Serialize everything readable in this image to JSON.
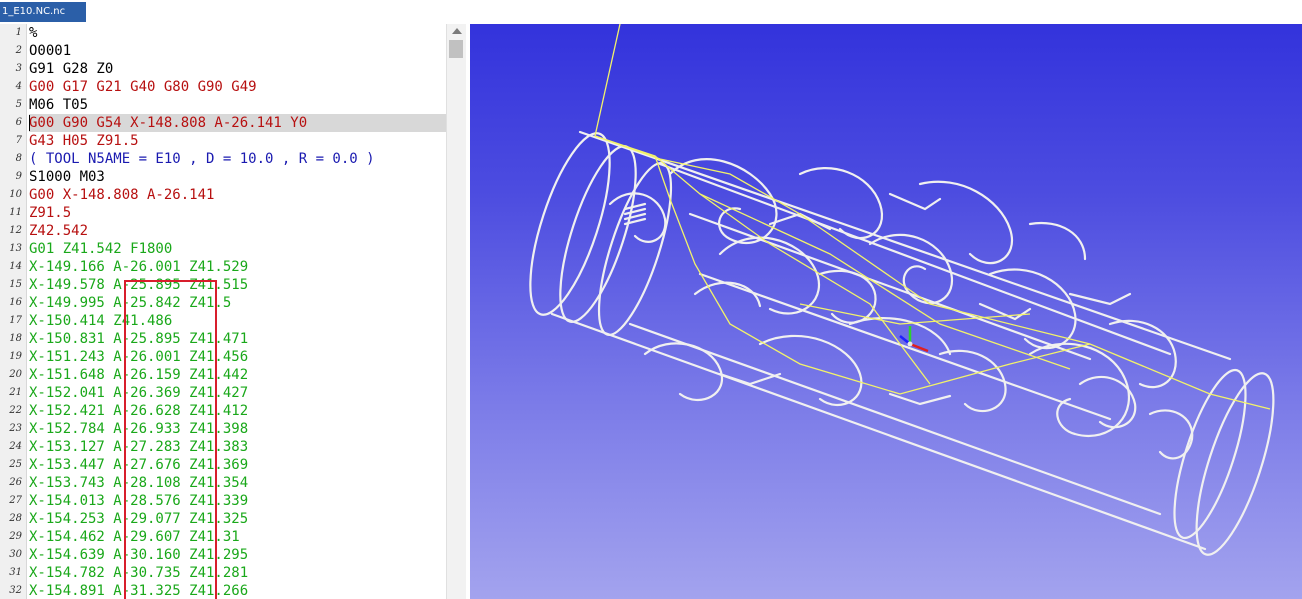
{
  "tab": {
    "title": "1_E10.NC.nc"
  },
  "editor": {
    "lines": [
      {
        "num": "1",
        "text": "%",
        "color": "#000000"
      },
      {
        "num": "2",
        "text": "O0001",
        "color": "#000000"
      },
      {
        "num": "3",
        "text": "G91 G28 Z0",
        "color": "#000000"
      },
      {
        "num": "4",
        "text": "G00 G17 G21 G40 G80 G90 G49",
        "color": "#b71010"
      },
      {
        "num": "5",
        "text": "M06 T05",
        "color": "#000000"
      },
      {
        "num": "6",
        "text": "G00 G90 G54 X-148.808 A-26.141 Y0",
        "color": "#b71010"
      },
      {
        "num": "7",
        "text": "G43 H05 Z91.5",
        "color": "#b71010"
      },
      {
        "num": "8",
        "text": "( TOOL N5AME = E10 , D = 10.0 , R = 0.0 )",
        "color": "#1a1ab0"
      },
      {
        "num": "9",
        "text": "S1000 M03",
        "color": "#000000"
      },
      {
        "num": "10",
        "text": "G00 X-148.808 A-26.141",
        "color": "#b71010"
      },
      {
        "num": "11",
        "text": "Z91.5",
        "color": "#b71010"
      },
      {
        "num": "12",
        "text": "Z42.542",
        "color": "#b71010"
      },
      {
        "num": "13",
        "text": "G01 Z41.542 F1800",
        "color": "#1aa81a"
      },
      {
        "num": "14",
        "text": "X-149.166 A-26.001 Z41.529",
        "color": "#1aa81a"
      },
      {
        "num": "15",
        "text": "X-149.578 A-25.895 Z41.515",
        "color": "#1aa81a"
      },
      {
        "num": "16",
        "text": "X-149.995 A-25.842 Z41.5",
        "color": "#1aa81a"
      },
      {
        "num": "17",
        "text": "X-150.414 Z41.486",
        "color": "#1aa81a"
      },
      {
        "num": "18",
        "text": "X-150.831 A-25.895 Z41.471",
        "color": "#1aa81a"
      },
      {
        "num": "19",
        "text": "X-151.243 A-26.001 Z41.456",
        "color": "#1aa81a"
      },
      {
        "num": "20",
        "text": "X-151.648 A-26.159 Z41.442",
        "color": "#1aa81a"
      },
      {
        "num": "21",
        "text": "X-152.041 A-26.369 Z41.427",
        "color": "#1aa81a"
      },
      {
        "num": "22",
        "text": "X-152.421 A-26.628 Z41.412",
        "color": "#1aa81a"
      },
      {
        "num": "23",
        "text": "X-152.784 A-26.933 Z41.398",
        "color": "#1aa81a"
      },
      {
        "num": "24",
        "text": "X-153.127 A-27.283 Z41.383",
        "color": "#1aa81a"
      },
      {
        "num": "25",
        "text": "X-153.447 A-27.676 Z41.369",
        "color": "#1aa81a"
      },
      {
        "num": "26",
        "text": "X-153.743 A-28.108 Z41.354",
        "color": "#1aa81a"
      },
      {
        "num": "27",
        "text": "X-154.013 A-28.576 Z41.339",
        "color": "#1aa81a"
      },
      {
        "num": "28",
        "text": "X-154.253 A-29.077 Z41.325",
        "color": "#1aa81a"
      },
      {
        "num": "29",
        "text": "X-154.462 A-29.607 Z41.31",
        "color": "#1aa81a"
      },
      {
        "num": "30",
        "text": "X-154.639 A-30.160 Z41.295",
        "color": "#1aa81a"
      },
      {
        "num": "31",
        "text": "X-154.782 A-30.735 Z41.281",
        "color": "#1aa81a"
      },
      {
        "num": "32",
        "text": "X-154.891 A-31.325 Z41.266",
        "color": "#1aa81a"
      }
    ],
    "current_line": "6",
    "highlight_color": "#d81e2c"
  },
  "viewport": {
    "toolpath_color": "#f2f26a",
    "wire_color": "#f0f0f0",
    "axes": [
      "x-axis-red",
      "y-axis-green",
      "z-axis-blue"
    ]
  }
}
